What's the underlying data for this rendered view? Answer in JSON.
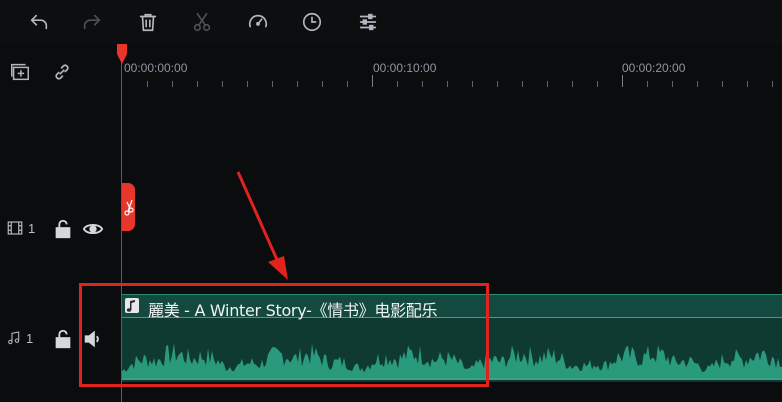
{
  "toolbar": {
    "buttons": [
      {
        "name": "undo-button",
        "icon": "undo-icon",
        "enabled": true
      },
      {
        "name": "redo-button",
        "icon": "redo-icon",
        "enabled": false
      },
      {
        "name": "delete-button",
        "icon": "trash-icon",
        "enabled": true
      },
      {
        "name": "cut-button",
        "icon": "scissors-icon",
        "enabled": false
      },
      {
        "name": "speed-button",
        "icon": "speedometer-icon",
        "enabled": true
      },
      {
        "name": "duration-button",
        "icon": "clock-icon",
        "enabled": true
      },
      {
        "name": "adjust-button",
        "icon": "sliders-icon",
        "enabled": true
      }
    ]
  },
  "ruler": {
    "timecodes": [
      "00:00:00:00",
      "00:00:10:00",
      "00:00:20:00"
    ]
  },
  "tracks": {
    "video": {
      "index_label": "1",
      "icon": "film-icon",
      "lock_icon": "unlock-icon",
      "visibility_icon": "eye-icon"
    },
    "audio": {
      "index_label": "1",
      "icon": "music-note-icon",
      "lock_icon": "unlock-icon",
      "volume_icon": "speaker-icon"
    }
  },
  "audio_clip": {
    "title": "麗美 - A Winter Story-《情书》电影配乐",
    "icon": "music-note-icon"
  },
  "colors": {
    "accent_red": "#e0231d",
    "clip_green": "#2a9a7c",
    "clip_bg": "#0e3a31"
  }
}
